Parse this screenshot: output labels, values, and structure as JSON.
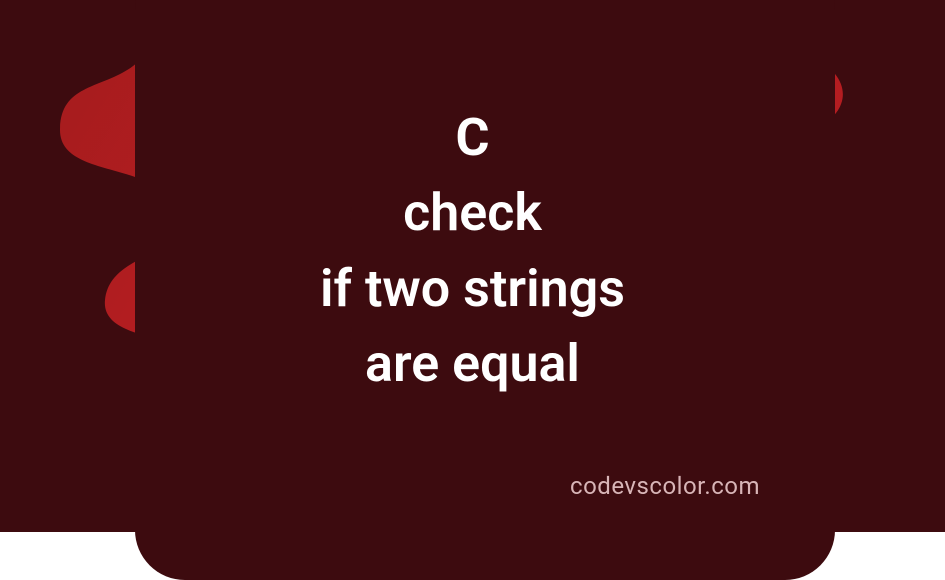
{
  "title": {
    "line1": "C",
    "line2": "check",
    "line3": "if two strings",
    "line4": "are equal"
  },
  "watermark": "codevscolor.com",
  "colors": {
    "bg_gradient_start": "#a01c1c",
    "bg_gradient_mid": "#c41e25",
    "blob": "#3d0b0f",
    "text": "#ffffff",
    "watermark": "#d8b5b7"
  }
}
